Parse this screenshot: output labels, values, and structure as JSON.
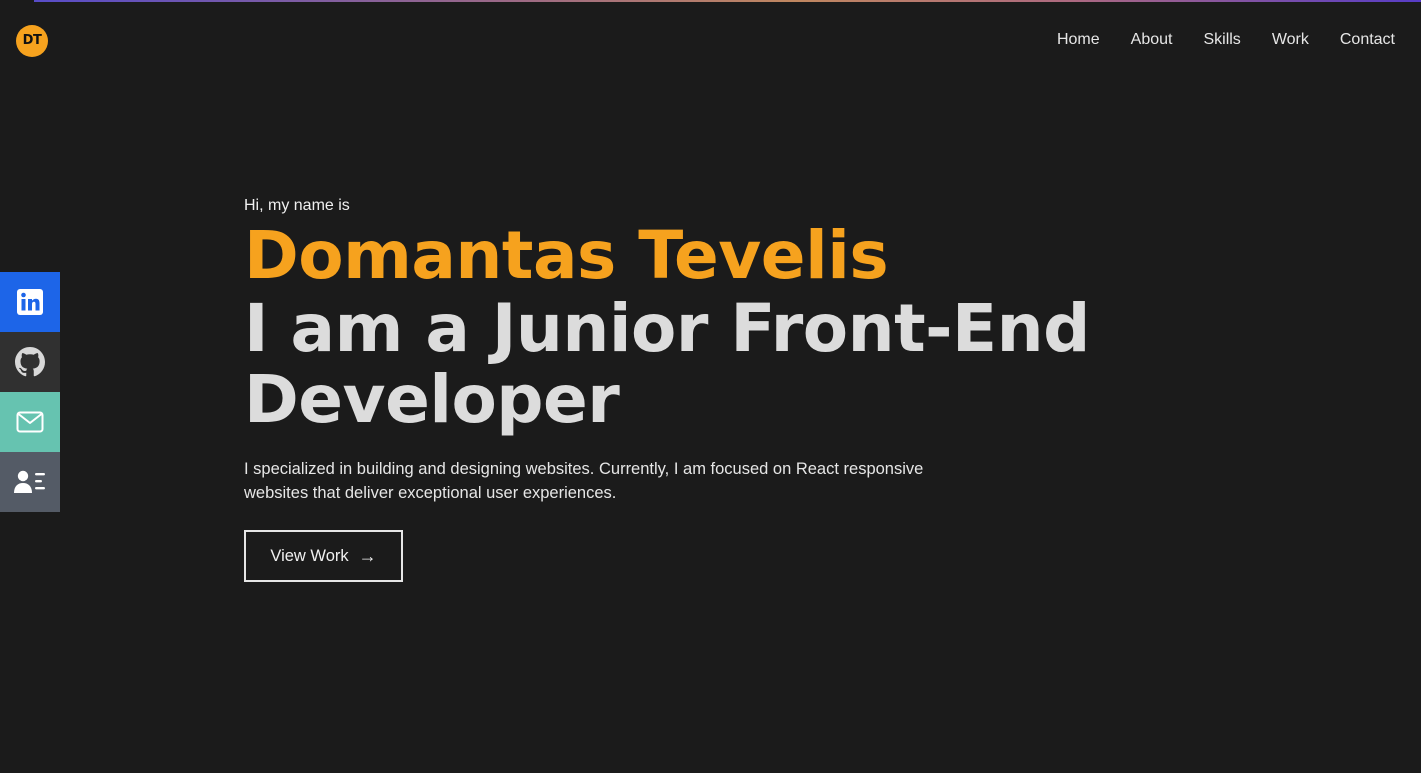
{
  "logo": {
    "text": "DT"
  },
  "nav": [
    {
      "label": "Home"
    },
    {
      "label": "About"
    },
    {
      "label": "Skills"
    },
    {
      "label": "Work"
    },
    {
      "label": "Contact"
    }
  ],
  "social": [
    {
      "icon": "linkedin-icon"
    },
    {
      "icon": "github-icon"
    },
    {
      "icon": "mail-icon"
    },
    {
      "icon": "resume-icon"
    }
  ],
  "hero": {
    "intro": "Hi, my name is",
    "name": "Domantas Tevelis",
    "role": "I am a Junior Front-End Developer",
    "description": "I specialized in building and designing websites. Currently, I am focused on React responsive websites that deliver exceptional user experiences.",
    "cta_label": "View Work"
  },
  "colors": {
    "background": "#1b1b1b",
    "accent": "#f6a21e",
    "linkedin": "#1d65e8",
    "github": "#303030",
    "email": "#66c3b0",
    "resume": "#545b66"
  }
}
